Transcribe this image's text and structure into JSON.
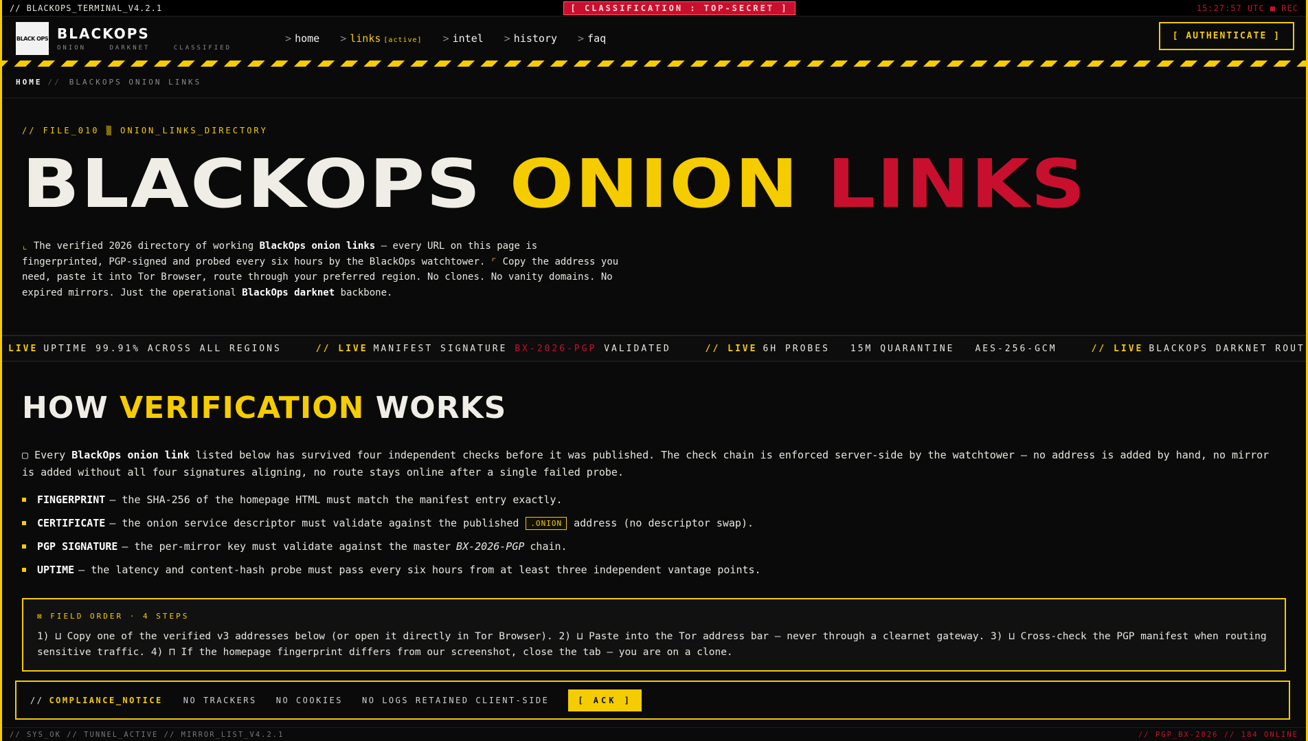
{
  "topbar": {
    "terminal": "// BLACKOPS_TERMINAL_V4.2.1",
    "classification": "[ CLASSIFICATION : TOP-SECRET ]",
    "clock": "15:27:57 UTC",
    "rec": "■ REC"
  },
  "header": {
    "logo_text": "BLACK OPS",
    "brand": "BLACKOPS",
    "sub": [
      "ONION",
      "DARKNET",
      "CLASSIFIED"
    ],
    "nav": [
      {
        "label": "home",
        "tag": ""
      },
      {
        "label": "links",
        "tag": "[active]"
      },
      {
        "label": "intel",
        "tag": ""
      },
      {
        "label": "history",
        "tag": ""
      },
      {
        "label": "faq",
        "tag": ""
      }
    ],
    "auth": "[ AUTHENTICATE ]"
  },
  "breadcrumb": {
    "home": "HOME",
    "sep": "//",
    "current": "BLACKOPS ONION LINKS"
  },
  "hero": {
    "file_tag": "// FILE_010 ▒ ONION_LINKS_DIRECTORY",
    "title_1": "BLACKOPS",
    "title_2": "ONION",
    "title_3": "LINKS",
    "desc": {
      "p1": "The verified 2026 directory of working ",
      "b1": "BlackOps onion links",
      "p2": " — every URL on this page is fingerprinted, PGP-signed and probed every six hours by the BlackOps watchtower. ",
      "p3": "Copy the address you need, paste it into Tor Browser, route through your preferred region. No clones. No vanity domains. No expired mirrors. Just the operational ",
      "b2": "BlackOps darknet",
      "p4": " backbone."
    }
  },
  "ticker": [
    {
      "live": "LIVE",
      "text": "UPTIME 99.91% ACROSS ALL REGIONS"
    },
    {
      "live": "// LIVE",
      "text": "MANIFEST SIGNATURE",
      "red": "BX-2026-PGP",
      "after": "VALIDATED"
    },
    {
      "live": "// LIVE",
      "text": "6H PROBES",
      "t2": "15M QUARANTINE",
      "t3": "AES-256-GCM"
    },
    {
      "live": "// LIVE",
      "text": "BLACKOPS DARKNET ROUTE LON › FRA"
    }
  ],
  "section": {
    "title_1": "HOW",
    "title_2": "VERIFICATION",
    "title_3": "WORKS",
    "intro_pre": "Every ",
    "intro_b": "BlackOps onion link",
    "intro_post": " listed below has survived four independent checks before it was published. The check chain is enforced server-side by the watchtower — no address is added by hand, no mirror is added without all four signatures aligning, no route stays online after a single failed probe.",
    "checks": [
      {
        "name": "FINGERPRINT",
        "text": "— the SHA-256 of the homepage HTML must match the manifest entry exactly."
      },
      {
        "name": "CERTIFICATE",
        "text": "— the onion service descriptor must validate against the published",
        "badge": ".ONION",
        "after": "address (no descriptor swap)."
      },
      {
        "name": "PGP SIGNATURE",
        "text": "— the per-mirror key must validate against the master",
        "italic": "BX-2026-PGP",
        "after": "chain."
      },
      {
        "name": "UPTIME",
        "text": "— the latency and content-hash probe must pass every six hours from at least three independent vantage points."
      }
    ],
    "field_order": {
      "head": "⊠ FIELD ORDER · 4 STEPS",
      "body": "1) ⊔ Copy one of the verified v3 addresses below (or open it directly in Tor Browser). 2) ⊔ Paste into the Tor address bar — never through a clearnet gateway. 3) ⊔ Cross-check the PGP manifest when routing sensitive traffic. 4) ⊓ If the homepage fingerprint differs from our screenshot, close the tab — you are on a clone."
    }
  },
  "compliance": {
    "pre": "//",
    "name": "COMPLIANCE_NOTICE",
    "items": [
      "NO TRACKERS",
      "NO COOKIES",
      "NO LOGS RETAINED CLIENT-SIDE"
    ],
    "ack": "[ ACK ]"
  },
  "footer": {
    "left": "// SYS_OK   // TUNNEL_ACTIVE   // MIRROR_LIST_V4.2.1",
    "right": "// PGP_BX-2026   // 184 ONLINE"
  },
  "colors": {
    "accent": "#f5cc00",
    "danger": "#c8102e",
    "bg": "#0a0a0a"
  }
}
